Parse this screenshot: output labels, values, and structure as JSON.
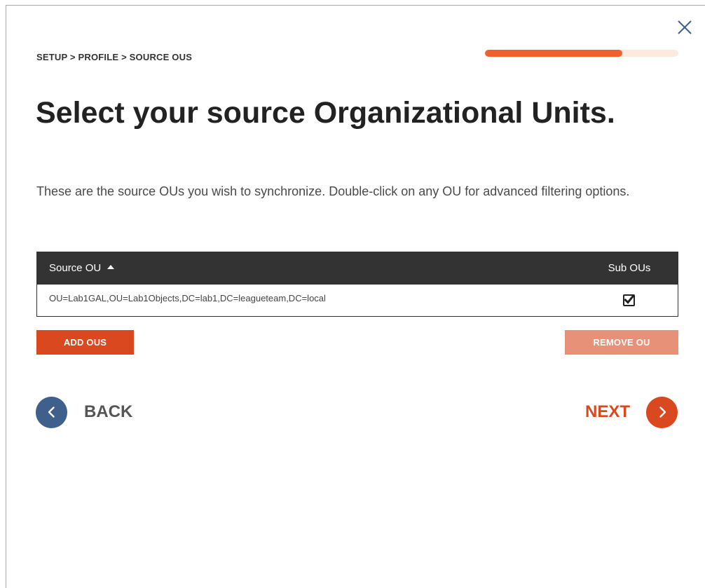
{
  "breadcrumb": "SETUP > PROFILE > SOURCE OUS",
  "progress": {
    "fraction": 0.71,
    "fill_color": "#f0602f",
    "track_color": "#fdeadf"
  },
  "title": "Select your source Organizational Units.",
  "subtitle": "These are the source OUs you wish to synchronize. Double-click on any OU for advanced filtering options.",
  "table": {
    "columns": [
      "Source OU",
      "Sub OUs"
    ],
    "sort": {
      "column": "Source OU",
      "direction": "ascending"
    },
    "rows": [
      {
        "source_ou": "OU=Lab1GAL,OU=Lab1Objects,DC=lab1,DC=leagueteam,DC=local",
        "sub_ous_checked": true
      }
    ]
  },
  "buttons": {
    "add": "ADD OUS",
    "remove": "REMOVE OU"
  },
  "nav": {
    "back": "BACK",
    "next": "NEXT"
  },
  "icons": {
    "close": "close-icon",
    "back": "chevron-left-icon",
    "next": "chevron-right-icon",
    "sort": "sort-ascending-icon",
    "check": "check-icon"
  },
  "colors": {
    "accent": "#d9481f",
    "accent_disabled": "#e69178",
    "back_circle": "#3f5f8c",
    "table_header": "#333333"
  }
}
